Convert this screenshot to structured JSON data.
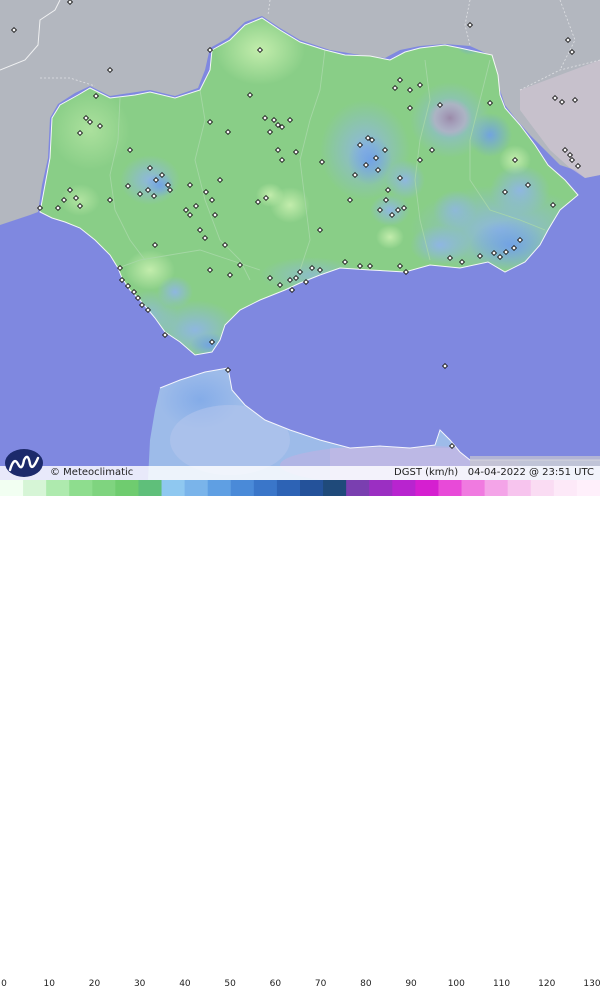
{
  "map": {
    "variable": "DGST (km/h)",
    "datetime": "04-04-2022 @ 23:51 UTC",
    "brand": "© Meteoclimatic",
    "colors": {
      "sea": "#7f88e0",
      "land_outside": "#b0b4bd",
      "region_base": "#86cc86"
    }
  },
  "legend": {
    "ticks": [
      "0",
      "10",
      "20",
      "30",
      "40",
      "50",
      "60",
      "70",
      "80",
      "90",
      "100",
      "110",
      "120",
      "130"
    ],
    "range": [
      0,
      130
    ],
    "colors": [
      "#f2fff2",
      "#d6f5d6",
      "#aeeaae",
      "#8edd8e",
      "#7fd47f",
      "#6fcc6f",
      "#5fbf7a",
      "#8fc8f0",
      "#7ab4ea",
      "#5f9fe3",
      "#4a8ad8",
      "#3a76c9",
      "#2d63b5",
      "#24529a",
      "#1f4a7a",
      "#7a3fb0",
      "#9b2fc2",
      "#b824cf",
      "#d51fd0",
      "#e84ad8",
      "#f07ae0",
      "#f4a4e8",
      "#f7c4ee",
      "#fadcf3",
      "#fde9f8",
      "#fff0fb"
    ]
  }
}
